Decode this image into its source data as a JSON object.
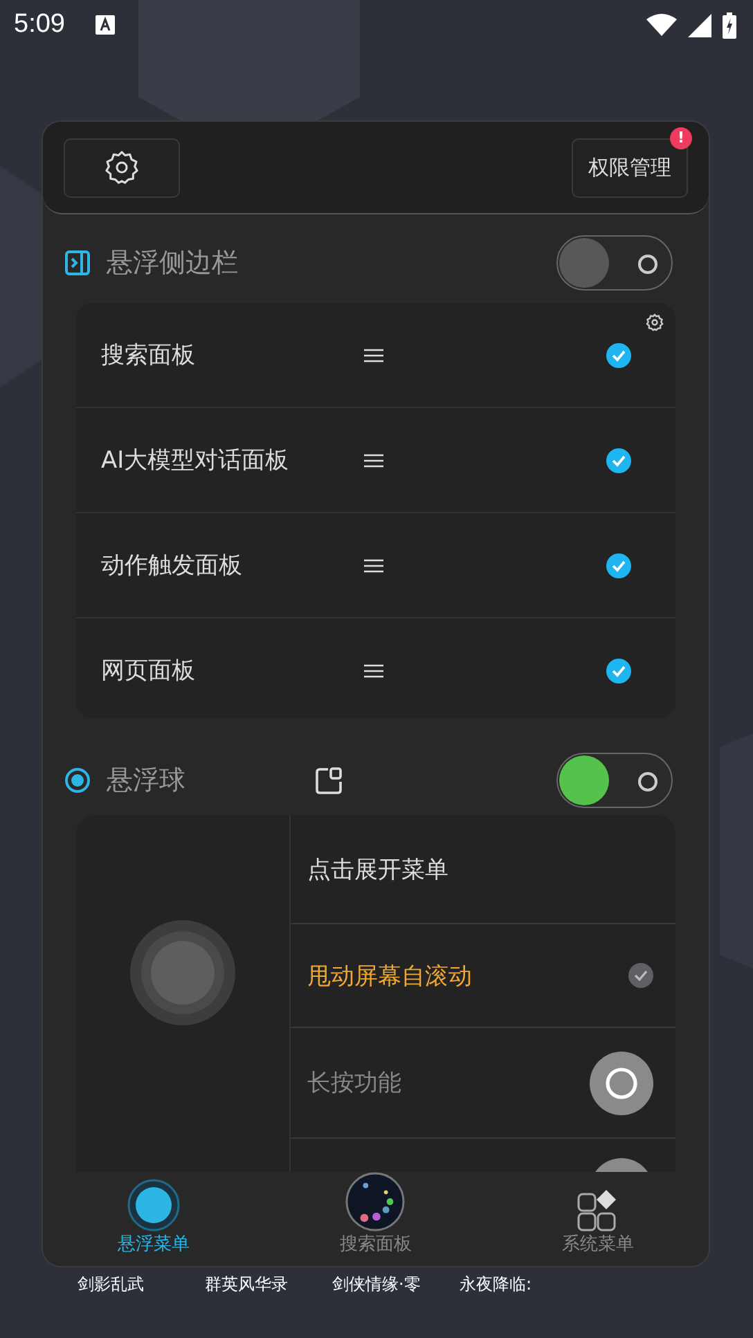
{
  "status_bar": {
    "time": "5:09"
  },
  "header": {
    "permission_button": "权限管理",
    "badge": "!"
  },
  "sidebar_section": {
    "title": "悬浮侧边栏",
    "on": false,
    "items": [
      {
        "label": "搜索面板",
        "checked": true
      },
      {
        "label": "AI大模型对话面板",
        "checked": true
      },
      {
        "label": "动作触发面板",
        "checked": true
      },
      {
        "label": "网页面板",
        "checked": true
      }
    ]
  },
  "ball_section": {
    "title": "悬浮球",
    "on": true,
    "options": [
      {
        "label": "点击展开菜单",
        "kind": "plain"
      },
      {
        "label": "甩动屏幕自滚动",
        "kind": "check",
        "checked": true,
        "highlighted": true
      },
      {
        "label": "长按功能",
        "kind": "action"
      },
      {
        "kind": "action"
      }
    ]
  },
  "bottom_nav": [
    {
      "label": "悬浮菜单",
      "selected": true
    },
    {
      "label": "搜索面板",
      "selected": false
    },
    {
      "label": "系统菜单",
      "selected": false
    }
  ],
  "app_labels": [
    "剑影乱武",
    "群英风华录",
    "剑侠情缘·零",
    "永夜降临:"
  ]
}
